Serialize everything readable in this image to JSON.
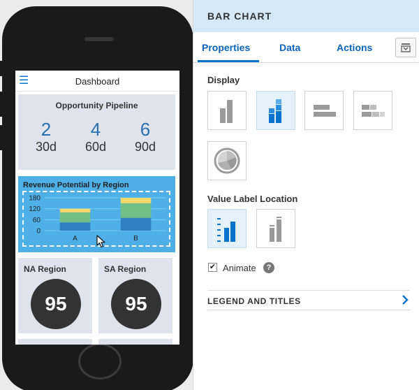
{
  "phone": {
    "app_title": "Dashboard",
    "pipeline": {
      "title": "Opportunity Pipeline",
      "items": [
        {
          "value": "2",
          "label": "30d"
        },
        {
          "value": "4",
          "label": "60d"
        },
        {
          "value": "6",
          "label": "90d"
        }
      ]
    },
    "revenue": {
      "title": "Revenue Potential by Region"
    },
    "regions": [
      {
        "title": "NA Region",
        "value": "95"
      },
      {
        "title": "SA Region",
        "value": "95"
      }
    ]
  },
  "chart_data": {
    "type": "bar",
    "stacked": true,
    "title": "Revenue Potential by Region",
    "categories": [
      "A",
      "B"
    ],
    "series": [
      {
        "values": [
          45,
          70
        ],
        "color": "#2f7fc1"
      },
      {
        "values": [
          55,
          80
        ],
        "color": "#6fbf86"
      },
      {
        "values": [
          20,
          30
        ],
        "color": "#f5d66a"
      }
    ],
    "y_ticks": [
      0,
      60,
      120,
      180
    ],
    "ylim": [
      0,
      180
    ],
    "grid": true
  },
  "panel": {
    "title": "BAR CHART",
    "tabs": [
      "Properties",
      "Data",
      "Actions"
    ],
    "active_tab": "Properties",
    "display_label": "Display",
    "display_options": [
      {
        "icon": "vertical-bar-icon",
        "selected": false
      },
      {
        "icon": "stacked-bar-icon",
        "selected": true
      },
      {
        "icon": "horizontal-bar-icon",
        "selected": false
      },
      {
        "icon": "horizontal-stacked-bar-icon",
        "selected": false
      },
      {
        "icon": "pie-chart-icon",
        "selected": false
      }
    ],
    "value_label_location_label": "Value Label Location",
    "value_label_options": [
      {
        "icon": "axis-labels-icon",
        "selected": true
      },
      {
        "icon": "bar-labels-icon",
        "selected": false
      }
    ],
    "animate_label": "Animate",
    "animate_checked": true,
    "legend_section_label": "LEGEND AND TITLES"
  },
  "colors": {
    "accent": "#0572ce",
    "header_bg": "#d4e8f8",
    "tile_bg": "#dfe4ec",
    "selected_tile": "#4eb0e6",
    "gauge": "#333333"
  }
}
